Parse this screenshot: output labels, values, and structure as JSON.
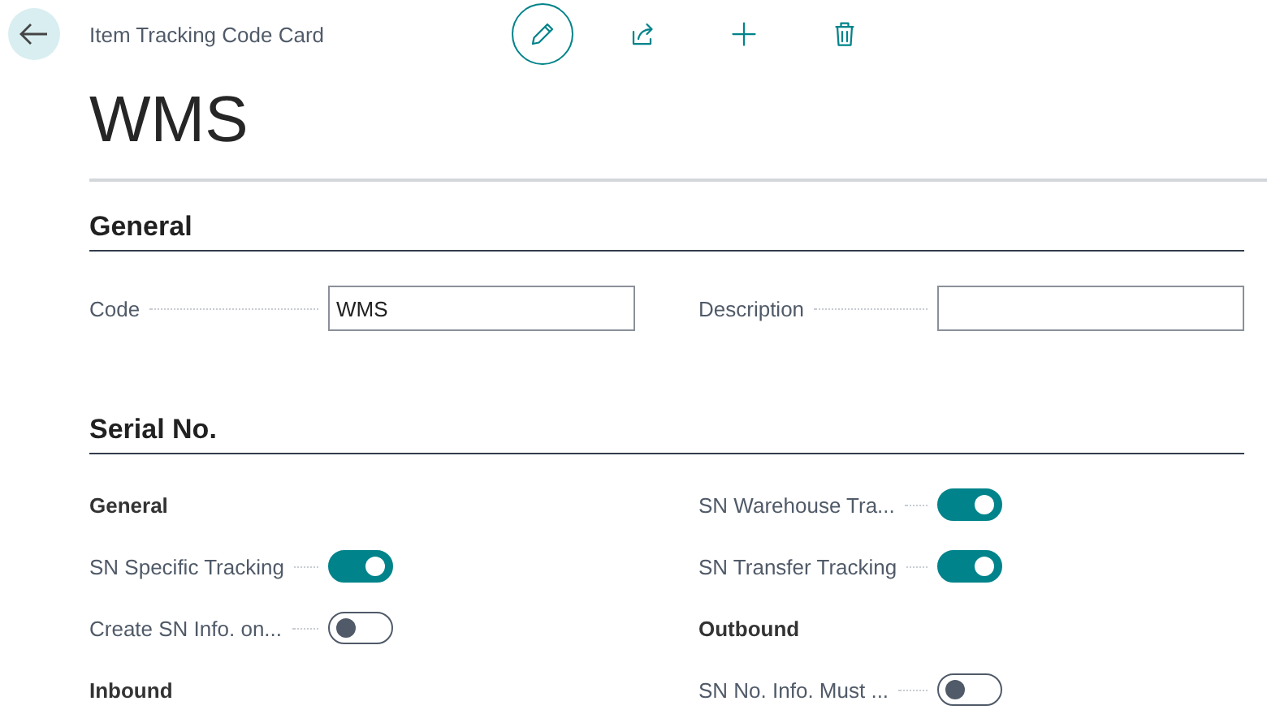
{
  "header": {
    "breadcrumb": "Item Tracking Code Card",
    "title": "WMS"
  },
  "sections": [
    {
      "title": "General",
      "kind": "fields",
      "left": [
        {
          "label": "Code",
          "value": "WMS"
        }
      ],
      "right": [
        {
          "label": "Description"
        }
      ]
    },
    {
      "title": "Serial No.",
      "kind": "toggles",
      "left": [
        {
          "kind": "heading",
          "label": "General"
        },
        {
          "kind": "toggle",
          "label": "SN Specific Tracking",
          "on": true
        },
        {
          "kind": "toggle",
          "label": "Create SN Info. on...",
          "on": false
        },
        {
          "kind": "heading",
          "label": "Inbound"
        }
      ],
      "right": [
        {
          "kind": "toggle",
          "label": "SN Warehouse Tra...",
          "on": true
        },
        {
          "kind": "toggle",
          "label": "SN Transfer Tracking",
          "on": true
        },
        {
          "kind": "heading",
          "label": "Outbound"
        },
        {
          "kind": "toggle",
          "label": "SN No. Info. Must ...",
          "on": false
        }
      ]
    }
  ]
}
